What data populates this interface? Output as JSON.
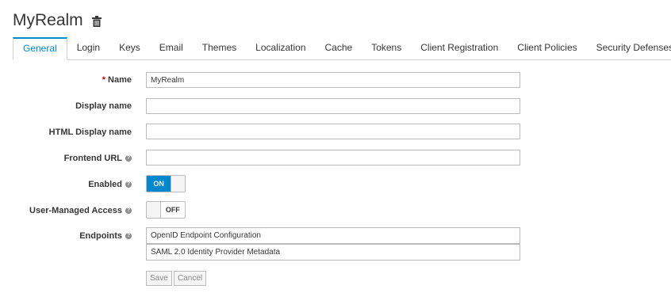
{
  "header": {
    "realm_name": "MyRealm",
    "delete_icon": "trash-icon"
  },
  "tabs": [
    {
      "label": "General",
      "active": true
    },
    {
      "label": "Login"
    },
    {
      "label": "Keys"
    },
    {
      "label": "Email"
    },
    {
      "label": "Themes"
    },
    {
      "label": "Localization"
    },
    {
      "label": "Cache"
    },
    {
      "label": "Tokens"
    },
    {
      "label": "Client Registration"
    },
    {
      "label": "Client Policies"
    },
    {
      "label": "Security Defenses"
    }
  ],
  "form": {
    "name": {
      "label": "Name",
      "required_mark": "*",
      "value": "MyRealm"
    },
    "display_name": {
      "label": "Display name",
      "value": ""
    },
    "html_display_name": {
      "label": "HTML Display name",
      "value": ""
    },
    "frontend_url": {
      "label": "Frontend URL",
      "value": "",
      "help_icon": "question-circle-icon"
    },
    "enabled": {
      "label": "Enabled",
      "state": "ON",
      "help_icon": "question-circle-icon"
    },
    "user_managed_access": {
      "label": "User-Managed Access",
      "state": "OFF",
      "help_icon": "question-circle-icon"
    },
    "endpoints": {
      "label": "Endpoints",
      "help_icon": "question-circle-icon",
      "items": [
        "OpenID Endpoint Configuration",
        "SAML 2.0 Identity Provider Metadata"
      ]
    }
  },
  "actions": {
    "save_label": "Save",
    "cancel_label": "Cancel"
  },
  "colors": {
    "accent": "#0088ce",
    "required": "#cc0000"
  }
}
